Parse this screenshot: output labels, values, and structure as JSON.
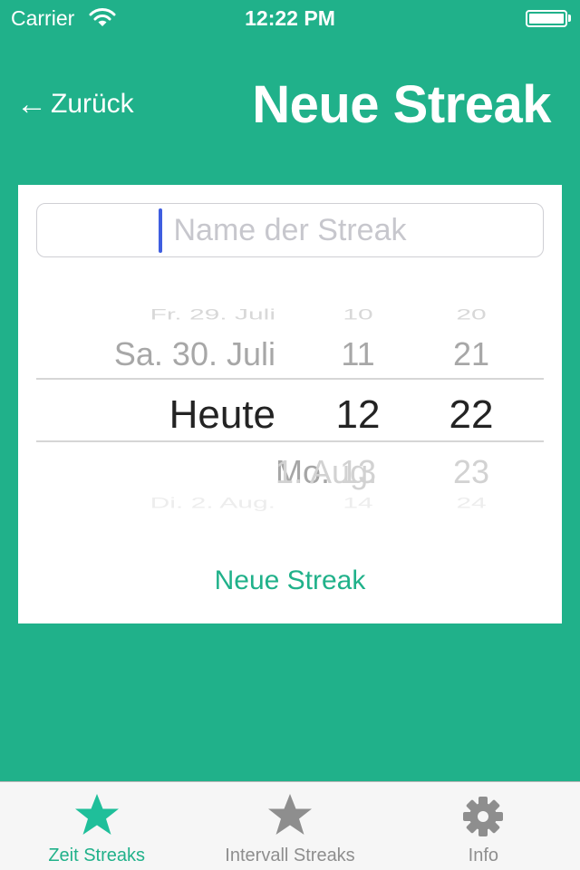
{
  "status_bar": {
    "carrier": "Carrier",
    "time": "12:22 PM",
    "battery_level": 1.0
  },
  "nav": {
    "back_label": "Zurück",
    "back_icon": "←",
    "title": "Neue Streak"
  },
  "form": {
    "name_placeholder": "Name der Streak",
    "name_value": "",
    "create_label": "Neue Streak"
  },
  "picker": {
    "rows": [
      {
        "date": "Fr. 29. Juli",
        "hour": "10",
        "minute": "20"
      },
      {
        "date": "Sa. 30. Juli",
        "hour": "11",
        "minute": "21"
      },
      {
        "date": "Heute",
        "hour": "12",
        "minute": "22"
      },
      {
        "date_prefix": "Mo.",
        "date": "1. Aug.",
        "hour": "13",
        "minute": "23"
      },
      {
        "date": "Di. 2. Aug.",
        "hour": "14",
        "minute": "24"
      }
    ],
    "selected": {
      "date": "Heute",
      "hour": "12",
      "minute": "22"
    }
  },
  "tabs": [
    {
      "label": "Zeit Streaks",
      "icon": "star-icon",
      "active": true
    },
    {
      "label": "Intervall Streaks",
      "icon": "star-icon",
      "active": false
    },
    {
      "label": "Info",
      "icon": "gear-icon",
      "active": false
    }
  ],
  "colors": {
    "brand": "#20b18a",
    "inactive": "#8e8e8e",
    "caret": "#3f5ee0"
  }
}
